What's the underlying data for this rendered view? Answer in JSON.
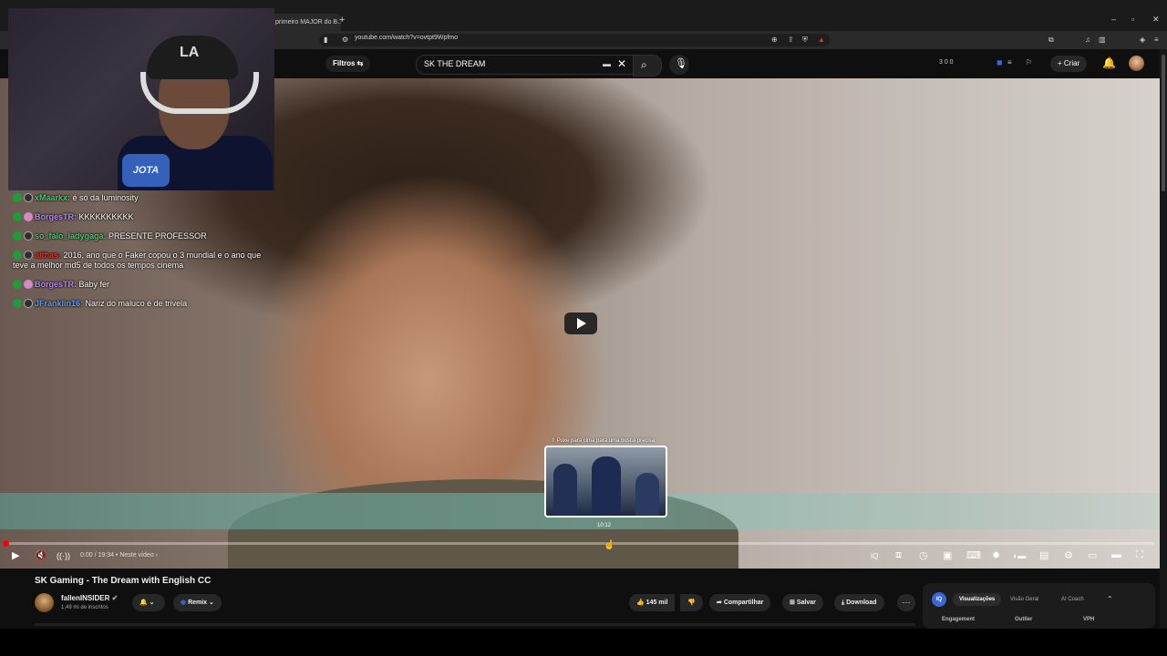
{
  "browser": {
    "tab_title": "primeiro MAJOR do B...",
    "url": "youtube.com/watch?v=ovtpt9Wpfmo",
    "new_tab": "+"
  },
  "yt_header": {
    "filter_label": "Filtros",
    "search_query": "SK THE DREAM",
    "stats": "3  0  0",
    "create_label": "Criar"
  },
  "chat": [
    {
      "user": "xMaarkx:",
      "text": "é só da luminosity",
      "user_color": "#3bd36b"
    },
    {
      "user": "BorgesTR:",
      "text": "KKKKKKKKKK",
      "user_color": "#b68cf0"
    },
    {
      "user": "so_falo_ladygaga:",
      "text": "PRESENTE PROFESSOR",
      "user_color": "#3bd36b"
    },
    {
      "user": "aithas:",
      "text": "2016, ano que o Faker copou o 3 mundial e o ano que teve a melhor md5 de todos os tempos cinema",
      "user_color": "#e0362c"
    },
    {
      "user": "BorgesTR:",
      "text": "Baby fer",
      "user_color": "#b68cf0"
    },
    {
      "user": "JFranklin16:",
      "text": "Nariz do maluco é de trivela",
      "user_color": "#5aa0ff"
    }
  ],
  "webcam": {
    "cap_text": "LA",
    "logo_text": "JOTA"
  },
  "player": {
    "preview_hint": "⇧ Puxe para cima para uma busca precisa",
    "preview_time": "10:12",
    "time": "0:00 / 19:34",
    "chapter": "Neste vídeo",
    "progress_fraction": 0.0
  },
  "video": {
    "title": "SK Gaming - The Dream with English CC",
    "channel": "fallenINSIDER",
    "subscribers": "1,49 mi de inscritos",
    "remix_label": "Remix",
    "likes": "145 mil",
    "share_label": "Compartilhar",
    "save_label": "Salvar",
    "download_label": "Download"
  },
  "side_panel": {
    "tabs": [
      "Visualizações",
      "Visão Geral",
      "AI Coach"
    ],
    "active_tab": 0,
    "labels": [
      "Engagement",
      "Outlier",
      "VPH"
    ]
  }
}
